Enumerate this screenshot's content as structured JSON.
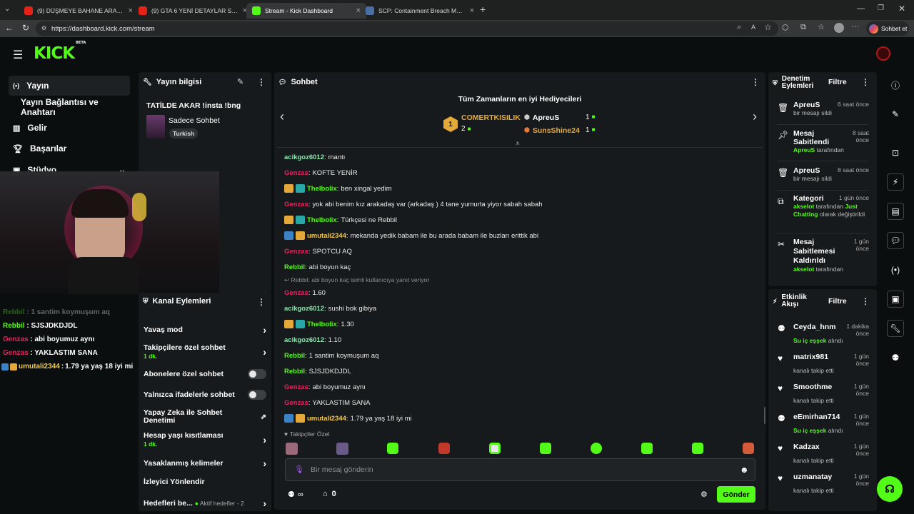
{
  "browser": {
    "tabs": [
      {
        "title": "(9) DÜŞMEYE BAHANE ARAMAK |",
        "icon": "youtube-icon"
      },
      {
        "title": "(9) GTA 6 YENİ DETAYLAR SIZDI! Y",
        "icon": "youtube-icon"
      },
      {
        "title": "Stream - Kick Dashboard",
        "icon": "kick-icon",
        "active": true
      },
      {
        "title": "SCP: Containment Breach Multipla",
        "icon": "steam-icon"
      }
    ],
    "url": "https://dashboard.kick.com/stream",
    "copilot_label": "Sohbet et"
  },
  "site": {
    "logo": "KICK",
    "logo_tag": "BETA"
  },
  "left_nav": {
    "items": [
      "Yayın",
      "Yayın Bağlantısı ve Anahtarı",
      "Gelir",
      "Başarılar",
      "Stüdyo"
    ]
  },
  "stream_info": {
    "title": "Yayın bilgisi",
    "stream_title": "TATİLDE AKAR !insta !bng",
    "category": "Sadece Sohbet",
    "tag": "Turkish"
  },
  "overlay_chat": [
    {
      "user": "Rebbil",
      "text": "1 santim koymuşum aq",
      "color": "#53fc18"
    },
    {
      "user": "Rebbil",
      "text": "SJSJDKDJDL",
      "color": "#53fc18"
    },
    {
      "user": "Genzas",
      "text": "abi boyumuz aynı",
      "color": "#e0245e"
    },
    {
      "user": "Genzas",
      "text": "YAKLASTIM SANA",
      "color": "#e0245e"
    },
    {
      "user": "umutali2344",
      "text": "1.79 ya yaş 18 iyi mi",
      "color": "#f2c94c"
    }
  ],
  "channel_actions": {
    "title": "Kanal Eylemleri",
    "items": [
      {
        "label": "Yavaş mod",
        "control": "arrow"
      },
      {
        "label": "Takipçilere özel sohbet",
        "sub": "1 dk.",
        "control": "arrow"
      },
      {
        "label": "Abonelere özel sohbet",
        "control": "toggle"
      },
      {
        "label": "Yalnızca ifadelerle sohbet",
        "control": "toggle"
      },
      {
        "label": "Yapay Zeka ile Sohbet Denetimi",
        "control": "external"
      },
      {
        "label": "Hesap yaşı kısıtlaması",
        "sub": "1 dk.",
        "control": "arrow"
      },
      {
        "label": "Yasaklanmış kelimeler",
        "control": "arrow"
      },
      {
        "label": "İzleyici Yönlendir",
        "control": "none"
      },
      {
        "label": "Hedefleri be...",
        "extra": "Aktif hedefler - 2",
        "control": "arrow"
      }
    ]
  },
  "chat": {
    "title": "Sohbet",
    "top_gifters_title": "Tüm Zamanların en iyi Hediyecileri",
    "gifters": [
      {
        "rank": "1",
        "name": "COMERTKISILIK",
        "count": "2"
      },
      {
        "rank": "2",
        "name": "ApreuS",
        "count": "1"
      },
      {
        "rank": "3",
        "name": "SunsShine24",
        "count": "1"
      }
    ],
    "messages": [
      {
        "user": "acikgoz6012",
        "text": "mantı",
        "color": "#8fe3b0",
        "badges": []
      },
      {
        "user": "Genzas",
        "text": "KOFTE YENİR",
        "color": "#e0245e",
        "badges": []
      },
      {
        "user": "Thelbolix",
        "text": "ben xingal yedim",
        "color": "#53fc18",
        "badges": [
          "crown",
          "cyan"
        ]
      },
      {
        "user": "Genzas",
        "text": "yok abi benim kız arakadaş var (arkadaş ) 4 tane yumurta yiyor sabah sabah",
        "color": "#e0245e",
        "badges": []
      },
      {
        "user": "Thelbolix",
        "text": "Türkçesi ne Rebbil",
        "color": "#53fc18",
        "badges": [
          "crown",
          "cyan"
        ]
      },
      {
        "user": "umutali2344",
        "text": "mekanda yedik babam ile bu arada babam ile buzları erittik abi",
        "color": "#f2c94c",
        "badges": [
          "blue",
          "crown"
        ]
      },
      {
        "user": "Genzas",
        "text": "SPOTCU AQ",
        "color": "#e0245e",
        "badges": []
      },
      {
        "user": "Rebbil",
        "text": "abi boyun kaç",
        "color": "#53fc18",
        "badges": []
      },
      {
        "user": "Genzas",
        "text": "1.60",
        "color": "#e0245e",
        "badges": [],
        "reply": "Rebbil: abi boyun kaç isimli kullanıcıya yanıt veriyor"
      },
      {
        "user": "acikgoz6012",
        "text": "sushi bok gibiya",
        "color": "#8fe3b0",
        "badges": []
      },
      {
        "user": "Thelbolix",
        "text": "1.30",
        "color": "#53fc18",
        "badges": [
          "crown",
          "cyan"
        ]
      },
      {
        "user": "acikgoz6012",
        "text": "1.10",
        "color": "#8fe3b0",
        "badges": []
      },
      {
        "user": "Rebbil",
        "text": "1 santim koymuşum aq",
        "color": "#53fc18",
        "badges": []
      },
      {
        "user": "Rebbil",
        "text": "SJSJDKDJDL",
        "color": "#53fc18",
        "badges": []
      },
      {
        "user": "Genzas",
        "text": "abi boyumuz aynı",
        "color": "#e0245e",
        "badges": []
      },
      {
        "user": "Genzas",
        "text": "YAKLASTIM SANA",
        "color": "#e0245e",
        "badges": []
      },
      {
        "user": "umutali2344",
        "text": "1.79 ya yaş 18 iyi mi",
        "color": "#f2c94c",
        "badges": [
          "blue",
          "crown"
        ]
      }
    ],
    "emote_label": "Takipçiler Özel",
    "input_placeholder": "Bir mesaj gönderin",
    "viewer_count": "∞",
    "points": "0",
    "send_label": "Gönder"
  },
  "mod_actions": {
    "title": "Denetim Eylemleri",
    "filter": "Filtre",
    "items": [
      {
        "icon": "trash-icon",
        "title": "ApreuS",
        "time": "6 saat önce",
        "sub": "bir mesajı sildi"
      },
      {
        "icon": "pin-icon",
        "title": "Mesaj Sabitlendi",
        "time": "8 saat önce",
        "sub_user": "ApreuS",
        "sub": "tarafından"
      },
      {
        "icon": "trash-icon",
        "title": "ApreuS",
        "time": "8 saat önce",
        "sub": "bir mesajı sildi"
      },
      {
        "icon": "category-icon",
        "title": "Kategori",
        "time": "1 gün önce",
        "sub_user": "akselot",
        "sub": "tarafından",
        "sub2": "Just Chatting",
        "sub3": "olarak değiştirildi"
      },
      {
        "icon": "unpin-icon",
        "title": "Mesaj Sabitlemesi Kaldırıldı",
        "time": "1 gün önce",
        "sub_user": "akselot",
        "sub": "tarafından"
      }
    ]
  },
  "activity": {
    "title": "Etkinlik Akışı",
    "filter": "Filtre",
    "items": [
      {
        "icon": "users-icon",
        "name": "Ceyda_hnm",
        "time": "1 dakika önce",
        "sub_hl": "Su iç eşşek",
        "sub": "alındı"
      },
      {
        "icon": "heart-icon",
        "name": "matrix981",
        "time": "1 gün önce",
        "sub": "kanalı takip etti"
      },
      {
        "icon": "heart-icon",
        "name": "Smoothme",
        "time": "1 gün önce",
        "sub": "kanalı takip etti"
      },
      {
        "icon": "users-icon",
        "name": "eEmirhan714",
        "time": "1 gün önce",
        "sub_hl": "Su iç eşşek",
        "sub": "alındı"
      },
      {
        "icon": "heart-icon",
        "name": "Kadzax",
        "time": "1 gün önce",
        "sub": "kanalı takip etti"
      },
      {
        "icon": "heart-icon",
        "name": "uzmanatay",
        "time": "1 gün önce",
        "sub": "kanalı takip etti"
      }
    ]
  }
}
